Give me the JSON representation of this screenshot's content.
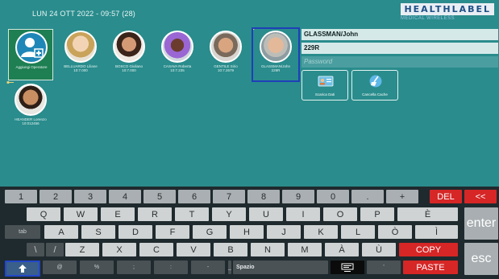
{
  "header": {
    "datetime": "LUN 24 OTT 2022 - 09:57 (28)"
  },
  "logo": {
    "main": "HEALTHLABEL",
    "sub": "MEDICAL WIRELESS"
  },
  "users": [
    {
      "caption": "Aggiungi Operatore",
      "type": "add"
    },
    {
      "caption": "BELLUARDO Liliane\n10:7.000"
    },
    {
      "caption": "BOSCO Giuliano\n10:7.000"
    },
    {
      "caption": "CASAVA Roberta\n10:7.235"
    },
    {
      "caption": "GENTILE Sirio\n10:7.2679"
    },
    {
      "caption": "GLASSMAN/John\n229R",
      "selected": true
    },
    {
      "caption": "HEANDER Lorenzo\n10:012456"
    }
  ],
  "panel": {
    "name": "GLASSMAN/John",
    "code": "229R",
    "password_placeholder": "Password",
    "actions": [
      {
        "label": "Scarica Dati",
        "icon": "id-card-icon"
      },
      {
        "label": "Cancella Cache",
        "icon": "broom-icon"
      }
    ]
  },
  "keyboard": {
    "row1": [
      "1",
      "2",
      "3",
      "4",
      "5",
      "6",
      "7",
      "8",
      "9",
      "0",
      ".",
      "+"
    ],
    "del": "DEL",
    "back": "<<",
    "row2": [
      "Q",
      "W",
      "E",
      "R",
      "T",
      "Y",
      "U",
      "I",
      "O",
      "P",
      "È"
    ],
    "enter": "enter",
    "tab": "tab",
    "row3": [
      "A",
      "S",
      "D",
      "F",
      "G",
      "H",
      "J",
      "K",
      "L",
      "Ò",
      "Ì"
    ],
    "row4": [
      "\\",
      "/",
      "Z",
      "X",
      "C",
      "V",
      "B",
      "N",
      "M",
      "À",
      "Ù"
    ],
    "copy": "COPY",
    "row5": [
      "@",
      "%",
      ";",
      ":",
      "-",
      "_"
    ],
    "space": "Spazio",
    "paste": "PASTE",
    "esc": "esc"
  },
  "colors": {
    "accent": "#2a8c8c",
    "danger": "#d62626",
    "selection": "#1e3fb8"
  }
}
